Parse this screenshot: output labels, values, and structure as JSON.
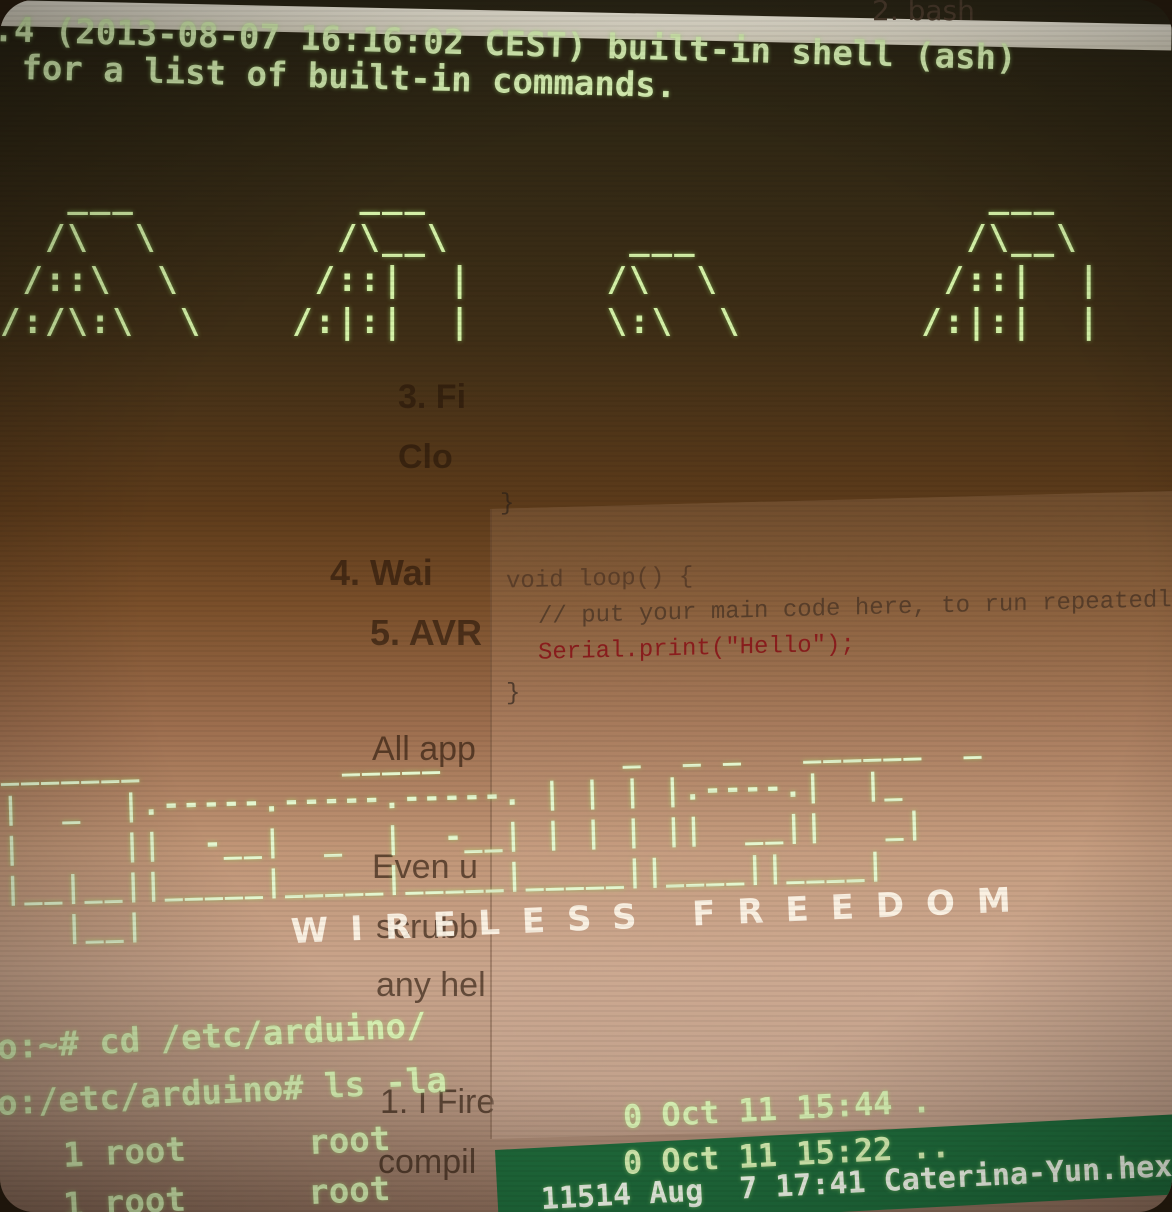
{
  "tab": {
    "label": "2. bash"
  },
  "terminal": {
    "banner_line1": ".4 (2013-08-07 16:16:02 CEST) built-in shell (ash)",
    "banner_line2": "for a list of built-in commands.",
    "ascii_logo": "   ___          ___                         ___                  ___           ___\n  /\\  \\        /\\__\\        ___            /\\__\\               /\\  \\\n /::\\  \\      /::|  |      /\\  \\          /::|  |             /::\\  \\\n/:/\\:\\  \\    /:|:|  |      \\:\\  \\        /:|:|  |            /:/\\:\\  \\",
    "brand_art": "_______          _____         _  _ _   ______  _\n|  _  |.-----.-----.-----. | | | |.----.|  |_\n|     ||  -__|  _  |  -__| | | | ||  __||   _|\n|__|__||_____|_____|_____|_____||____||____|\n   |__|",
    "tagline": "WIRELESS  FREEDOM",
    "cmd1": "o:~# cd /etc/arduino/",
    "cmd2": "o:/etc/arduino# ls -la",
    "ls_row1": "1 root      root",
    "ls_row2": "1 root      root",
    "ls_time1": "0 Oct 11 15:44 .",
    "ls_time2": "0 Oct 11 15:22 ..",
    "ls_file": "11514 Aug  7 17:41 Caterina-Yun.hex"
  },
  "page": {
    "step3": "3. Fi",
    "step3b": "Clo",
    "step4": "4. Wai",
    "step5": "5. AVR",
    "all_app": "All app",
    "even_u": "Even u",
    "scrubb": "scrubb",
    "any_hel": "any hel",
    "fire": "1. I Fire",
    "compil": "compil"
  },
  "editor": {
    "line_close_brace": "}",
    "line_loop": "void loop() {",
    "line_comment": "// put your main code here, to run repeatedly:",
    "line_print": "Serial.print(\"Hello\");",
    "line_end_brace": "}"
  },
  "colors": {
    "terminal_green": "#d4f1a7",
    "code_string": "#8b1d1d",
    "ls_highlight": "#1f6b3b"
  }
}
